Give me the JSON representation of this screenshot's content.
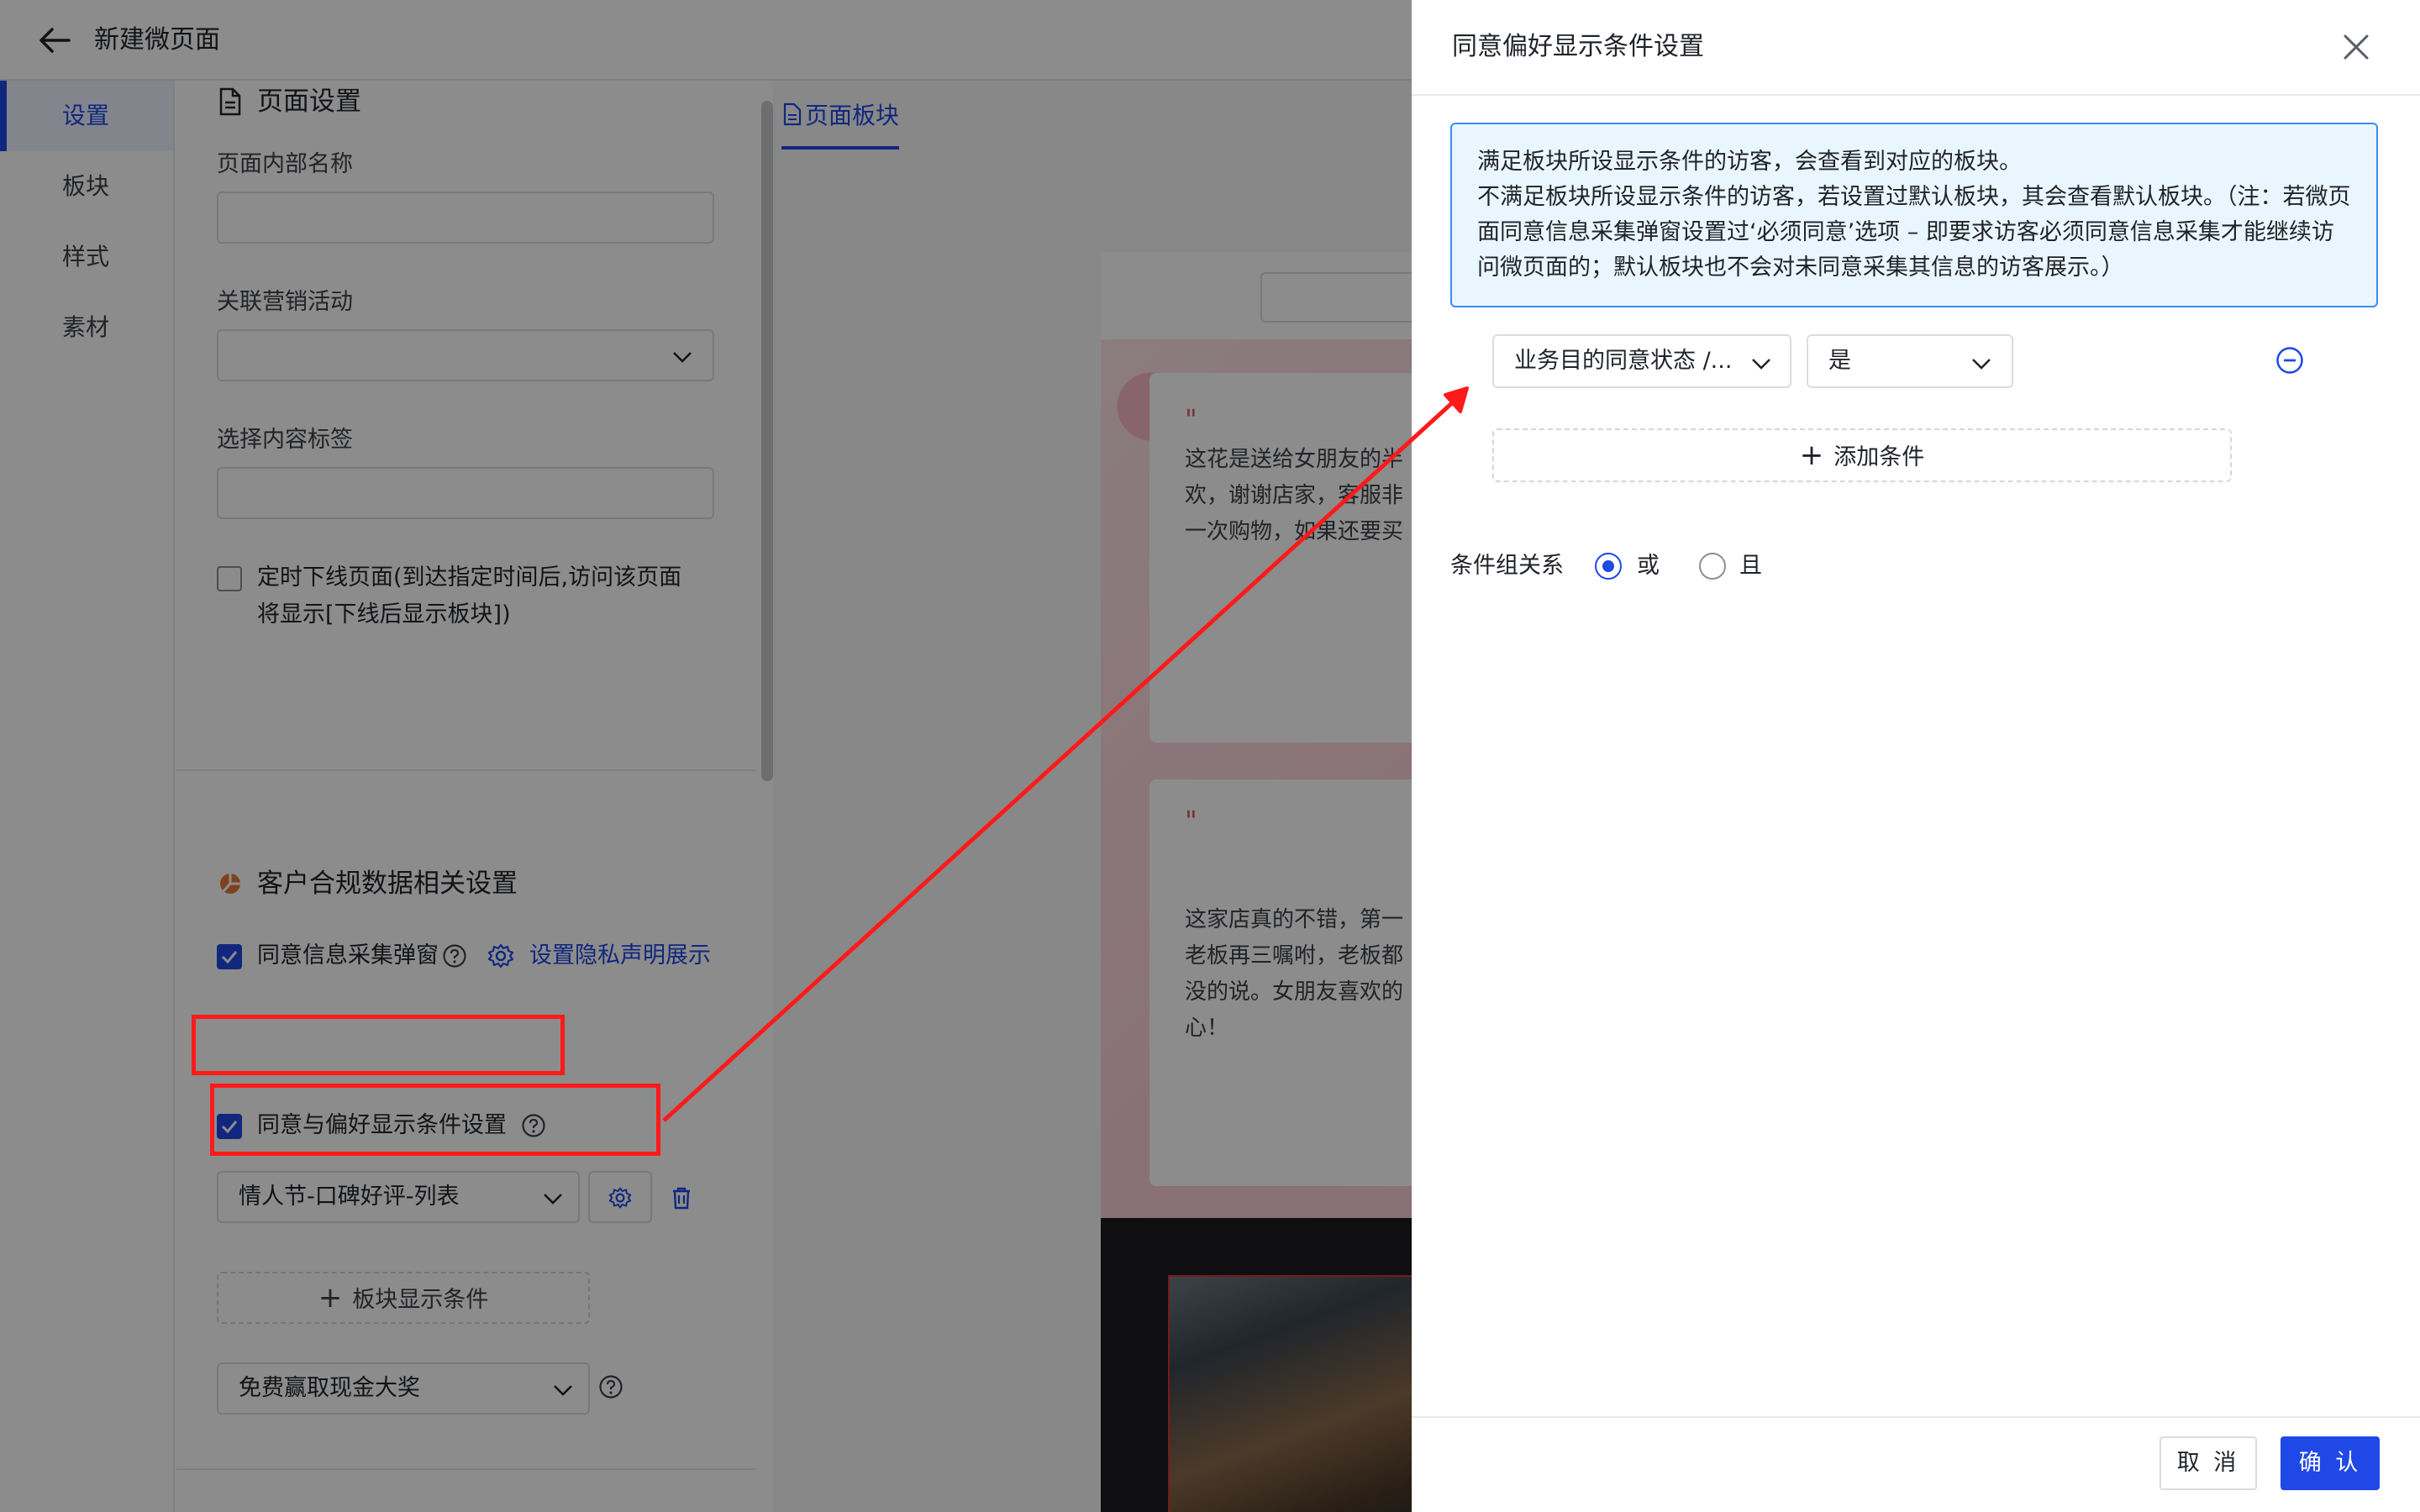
{
  "header": {
    "title": "新建微页面"
  },
  "nav": {
    "items": [
      "设置",
      "板块",
      "样式",
      "素材"
    ],
    "active": "设置"
  },
  "page_settings": {
    "title": "页面设置",
    "internal_name_label": "页面内部名称",
    "campaign_label": "关联营销活动",
    "tag_label": "选择内容标签",
    "offline_label_line1": "定时下线页面(到达指定时间后,访问该页面",
    "offline_label_line2": "将显示[下线后显示板块])"
  },
  "compliance": {
    "title": "客户合规数据相关设置",
    "consent_popup_label": "同意信息采集弹窗",
    "privacy_link": "设置隐私声明展示",
    "pref_condition_label": "同意与偏好显示条件设置",
    "block_select": "情人节-口碑好评-列表",
    "add_block_condition": "板块显示条件",
    "prize_select": "免费赢取现金大奖"
  },
  "preview": {
    "tab": "页面板块",
    "reviews": [
      {
        "quote": "\"",
        "text": "这花是送给女朋友的半\n欢，谢谢店家，客服非\n一次购物，如果还要买"
      },
      {
        "quote": "\"",
        "text": "这家店真的不错，第一\n老板再三嘱咐，老板都\n没的说。女朋友喜欢的\n心！"
      }
    ]
  },
  "drawer": {
    "title": "同意偏好显示条件设置",
    "notice_line1": "满足板块所设显示条件的访客，会查看到对应的板块。",
    "notice_line2": "不满足板块所设显示条件的访客，若设置过默认板块，其会查看默认板块。（注：若微页面同意信息采集弹窗设置过‘必须同意’选项 – 即要求访客必须同意信息采集才能继续访问微页面的；默认板块也不会对未同意采集其信息的访客展示。）",
    "condition_field": "业务目的同意状态 /...",
    "condition_value": "是",
    "add_condition": "添加条件",
    "relation_label": "条件组关系",
    "relation_or": "或",
    "relation_and": "且",
    "relation_selected": "或",
    "cancel_label": "取 消",
    "confirm_label": "确 认"
  },
  "colors": {
    "primary": "#1f48e6",
    "annotation": "#ff1a1a",
    "notice_bg": "#eaf6ff",
    "notice_border": "#3d8bf5"
  }
}
